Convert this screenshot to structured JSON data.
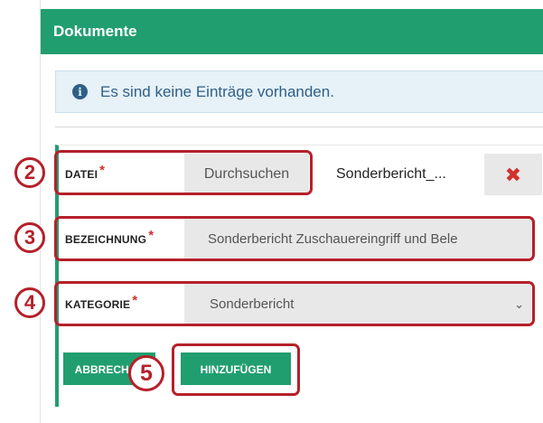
{
  "panel": {
    "title": "Dokumente"
  },
  "info": {
    "icon": "info-circle-icon",
    "text": "Es sind keine Einträge vorhanden."
  },
  "fields": {
    "datei": {
      "label": "DATEI",
      "required_mark": "*",
      "browse_label": "Durchsuchen",
      "file_name": "Sonderbericht_...",
      "remove_icon": "close-x-icon"
    },
    "bezeichnung": {
      "label": "BEZEICHNUNG",
      "required_mark": "*",
      "value": "Sonderbericht Zuschauereingriff und Bele"
    },
    "kategorie": {
      "label": "KATEGORIE",
      "required_mark": "*",
      "selected": "Sonderbericht"
    }
  },
  "buttons": {
    "cancel": "ABBRECHEN",
    "add": "HINZUFÜGEN"
  },
  "annotations": [
    "2",
    "3",
    "4",
    "5"
  ],
  "colors": {
    "accent": "#219e6f",
    "annotation": "#b5202a",
    "info_bg": "#e6f1f8",
    "remove": "#d0312d"
  }
}
